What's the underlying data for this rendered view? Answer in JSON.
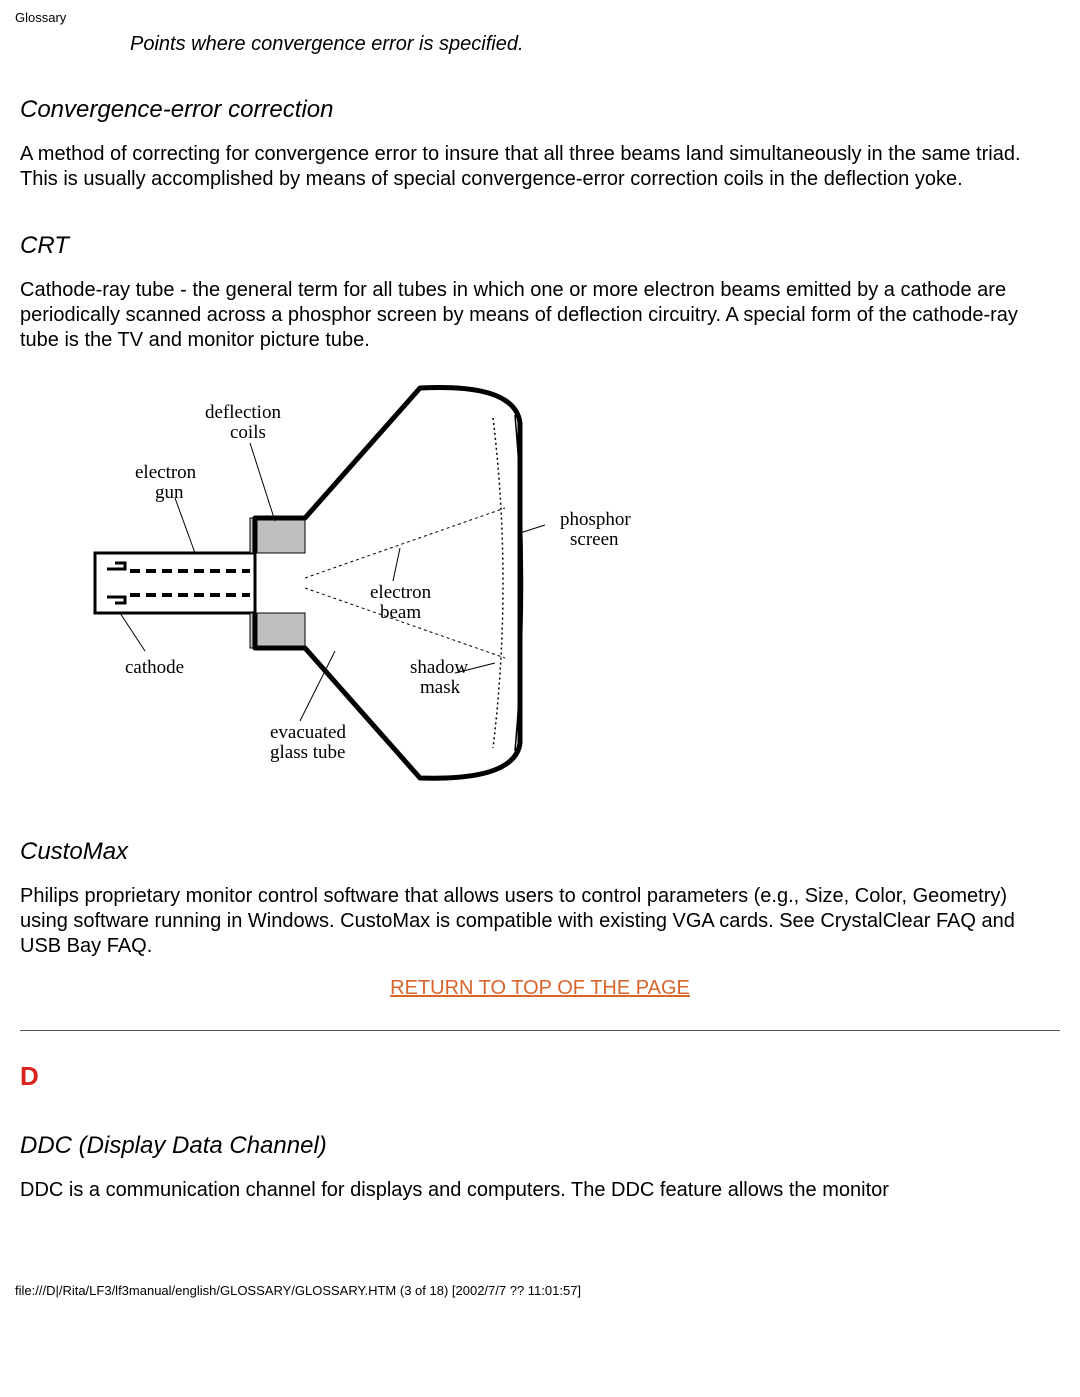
{
  "header": "Glossary",
  "caption": "Points where convergence error is specified.",
  "entries": {
    "convergence_correction": {
      "term": "Convergence-error correction",
      "def": "A method of correcting for convergence error to insure that all three beams land simultaneously in the same triad. This is usually accomplished by means of special convergence-error correction coils in the deflection yoke."
    },
    "crt": {
      "term": "CRT",
      "def": "Cathode-ray tube - the general term for all tubes in which one or more electron beams emitted by a cathode are periodically scanned across a phosphor screen by means of deflection circuitry. A special form of the cathode-ray tube is the TV and monitor picture tube."
    },
    "custom_max": {
      "term": "CustoMax",
      "def": "Philips proprietary monitor control software that allows users to control parameters (e.g., Size, Color, Geometry) using software running in Windows. CustoMax is compatible with existing VGA cards. See CrystalClear FAQ and USB Bay FAQ."
    },
    "ddc": {
      "term": "DDC (Display Data Channel)",
      "def": "DDC is a communication channel for displays and computers. The DDC feature allows the monitor"
    }
  },
  "diagram": {
    "deflection_coils": "deflection\ncoils",
    "electron_gun": "electron\ngun",
    "cathode": "cathode",
    "evacuated_glass_tube": "evacuated\nglass tube",
    "electron_beam": "electron\nbeam",
    "shadow_mask": "shadow\nmask",
    "phosphor_screen": "phosphor\nscreen"
  },
  "return_link": "RETURN TO TOP OF THE PAGE",
  "letter_d": "D",
  "footer": "file:///D|/Rita/LF3/lf3manual/english/GLOSSARY/GLOSSARY.HTM (3 of 18) [2002/7/7 ?? 11:01:57]"
}
